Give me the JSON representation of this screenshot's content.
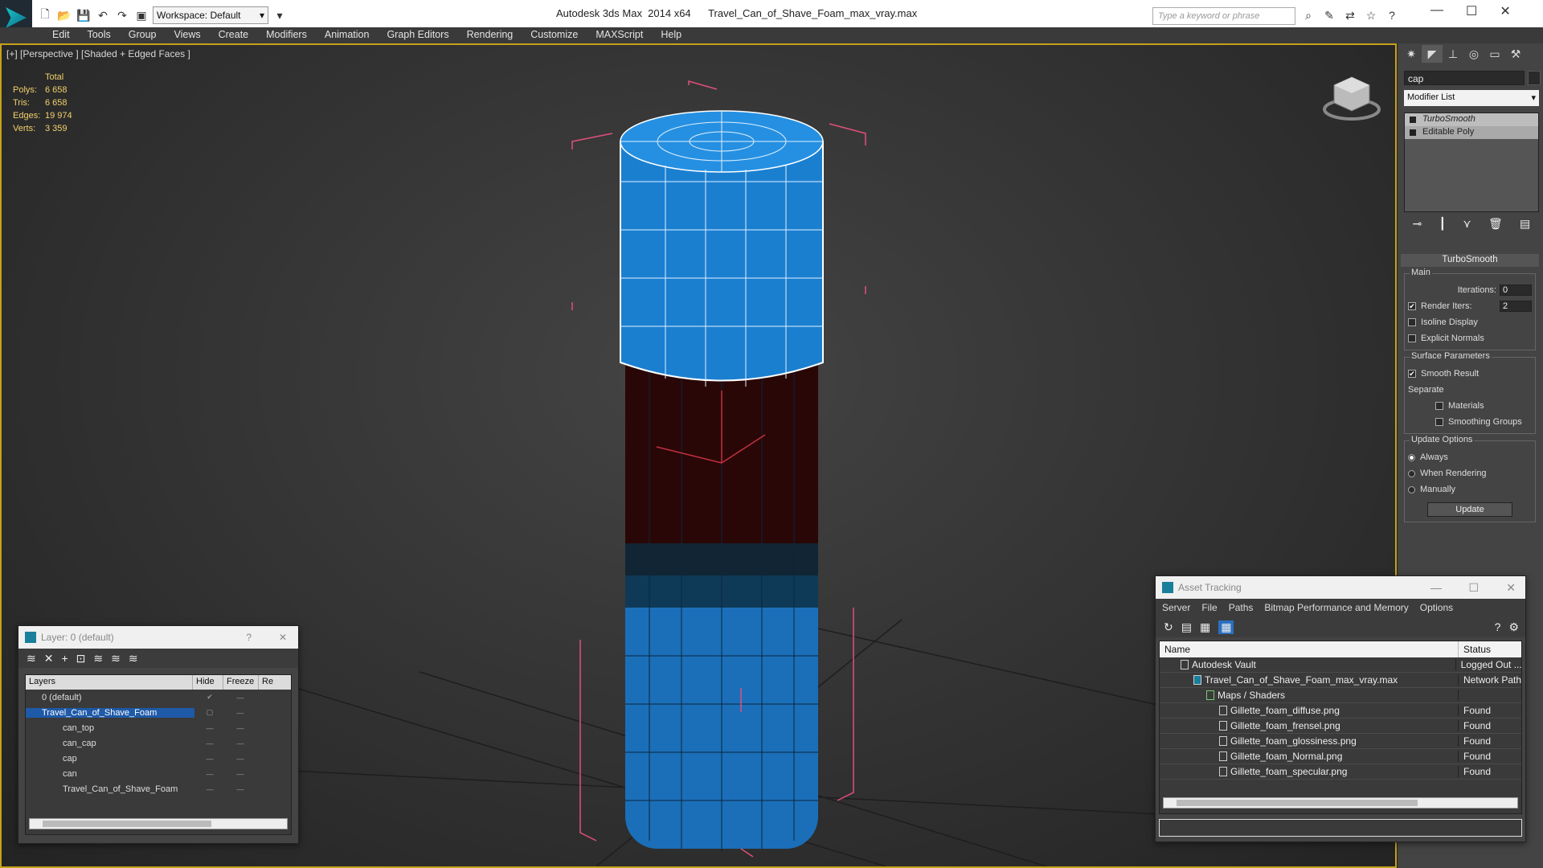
{
  "app": {
    "title": "Autodesk 3ds Max  2014 x64      Travel_Can_of_Shave_Foam_max_vray.max",
    "workspace": "Workspace: Default",
    "search_placeholder": "Type a keyword or phrase"
  },
  "menu": [
    "Edit",
    "Tools",
    "Group",
    "Views",
    "Create",
    "Modifiers",
    "Animation",
    "Graph Editors",
    "Rendering",
    "Customize",
    "MAXScript",
    "Help"
  ],
  "viewport": {
    "label": "[+] [Perspective ] [Shaded + Edged Faces ]",
    "stats_header": "Total",
    "stats": [
      {
        "k": "Polys:",
        "v": "6 658"
      },
      {
        "k": "Tris:",
        "v": "6 658"
      },
      {
        "k": "Edges:",
        "v": "19 974"
      },
      {
        "k": "Verts:",
        "v": "3 359"
      }
    ],
    "accent": "#c6a21a",
    "cap_color": "#1b7fd0",
    "can_color": "#1b6fb8"
  },
  "command_panel": {
    "object_name": "cap",
    "modifier_list": "Modifier List",
    "stack": [
      {
        "label": "TurboSmooth"
      },
      {
        "label": "Editable Poly"
      }
    ],
    "turbosmooth": {
      "title": "TurboSmooth",
      "main_group": "Main",
      "iterations_label": "Iterations:",
      "iterations_value": "0",
      "render_iters_label": "Render Iters:",
      "render_iters_value": "2",
      "isoline": "Isoline Display",
      "explicit_normals": "Explicit Normals",
      "surface_group": "Surface Parameters",
      "smooth_result": "Smooth Result",
      "separate": "Separate",
      "materials": "Materials",
      "smoothing_groups": "Smoothing Groups",
      "update_group": "Update Options",
      "always": "Always",
      "when_rendering": "When Rendering",
      "manually": "Manually",
      "update_button": "Update"
    }
  },
  "layer_window": {
    "title": "Layer: 0 (default)",
    "help": "?",
    "close": "✕",
    "columns": [
      "Layers",
      "Hide",
      "Freeze",
      "Re"
    ],
    "rows": [
      {
        "name": "0 (default)",
        "indent": 1
      },
      {
        "name": "Travel_Can_of_Shave_Foam",
        "indent": 1
      },
      {
        "name": "can_top",
        "indent": 2
      },
      {
        "name": "can_cap",
        "indent": 2
      },
      {
        "name": "cap",
        "indent": 2
      },
      {
        "name": "can",
        "indent": 2
      },
      {
        "name": "Travel_Can_of_Shave_Foam",
        "indent": 2
      }
    ]
  },
  "asset_window": {
    "title": "Asset Tracking",
    "menu": [
      "Server",
      "File",
      "Paths",
      "Bitmap Performance and Memory",
      "Options"
    ],
    "columns": [
      "Name",
      "Status"
    ],
    "rows": [
      {
        "name": "Autodesk Vault",
        "status": "Logged Out ...",
        "indent": 1
      },
      {
        "name": "Travel_Can_of_Shave_Foam_max_vray.max",
        "status": "Network Path",
        "indent": 2
      },
      {
        "name": "Maps / Shaders",
        "status": "",
        "indent": 3
      },
      {
        "name": "Gillette_foam_diffuse.png",
        "status": "Found",
        "indent": 4
      },
      {
        "name": "Gillette_foam_frensel.png",
        "status": "Found",
        "indent": 4
      },
      {
        "name": "Gillette_foam_glossiness.png",
        "status": "Found",
        "indent": 4
      },
      {
        "name": "Gillette_foam_Normal.png",
        "status": "Found",
        "indent": 4
      },
      {
        "name": "Gillette_foam_specular.png",
        "status": "Found",
        "indent": 4
      }
    ]
  }
}
